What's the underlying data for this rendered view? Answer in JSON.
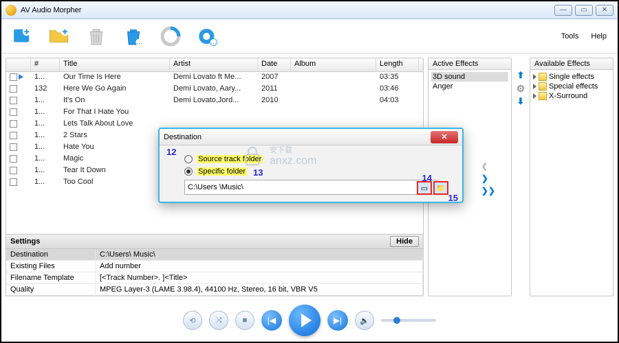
{
  "app_title": "AV Audio Morpher",
  "menu": {
    "tools": "Tools",
    "help": "Help"
  },
  "columns": {
    "num": "#",
    "title": "Title",
    "artist": "Artist",
    "date": "Date",
    "album": "Album",
    "length": "Length"
  },
  "tracks": [
    {
      "n": "1...",
      "title": "Our Time Is Here",
      "artist": "Demi Lovato ft Me...",
      "date": "2007",
      "album": "",
      "length": "03:35"
    },
    {
      "n": "132",
      "title": "Here We Go Again",
      "artist": "Demi Lovato, Aary...",
      "date": "2011",
      "album": "",
      "length": "03:46"
    },
    {
      "n": "1...",
      "title": "It's On",
      "artist": "Demi Lovato,Jord...",
      "date": "2010",
      "album": "",
      "length": "04:03"
    },
    {
      "n": "1...",
      "title": "For That I Hate You",
      "artist": "",
      "date": "",
      "album": "",
      "length": ""
    },
    {
      "n": "1...",
      "title": "Lets Talk About Love",
      "artist": "",
      "date": "",
      "album": "",
      "length": ""
    },
    {
      "n": "1...",
      "title": "2 Stars",
      "artist": "",
      "date": "",
      "album": "",
      "length": ""
    },
    {
      "n": "1...",
      "title": "Hate You",
      "artist": "",
      "date": "",
      "album": "",
      "length": ""
    },
    {
      "n": "1...",
      "title": "Magic",
      "artist": "",
      "date": "",
      "album": "",
      "length": ""
    },
    {
      "n": "1...",
      "title": "Tear It Down",
      "artist": "",
      "date": "",
      "album": "",
      "length": ""
    },
    {
      "n": "1...",
      "title": "Too Cool",
      "artist": "",
      "date": "",
      "album": "",
      "length": ""
    }
  ],
  "settings": {
    "header": "Settings",
    "hide": "Hide",
    "rows": {
      "destination_label": "Destination",
      "destination_value": "C:\\Users\\          Music\\",
      "existing_label": "Existing Files",
      "existing_value": "Add number",
      "template_label": "Filename Template",
      "template_value": "[<Track Number>. ]<Title>",
      "quality_label": "Quality",
      "quality_value": "MPEG Layer-3 (LAME 3.98.4), 44100 Hz, Stereo, 16 bit, VBR V5"
    }
  },
  "active": {
    "header": "Active Effects",
    "items": [
      "3D sound",
      "Anger"
    ]
  },
  "available": {
    "header": "Available Effects",
    "items": [
      "Single effects",
      "Special effects",
      "X-Surround"
    ]
  },
  "dialog": {
    "title": "Destination",
    "opt1": "Source track folder",
    "opt2": "Specific folder",
    "path": "C:\\Users           \\Music\\"
  },
  "anno": {
    "a12": "12",
    "a13": "13",
    "a14": "14",
    "a15": "15"
  },
  "watermark": {
    "cn": "安下载",
    "en": "anxz.com"
  }
}
